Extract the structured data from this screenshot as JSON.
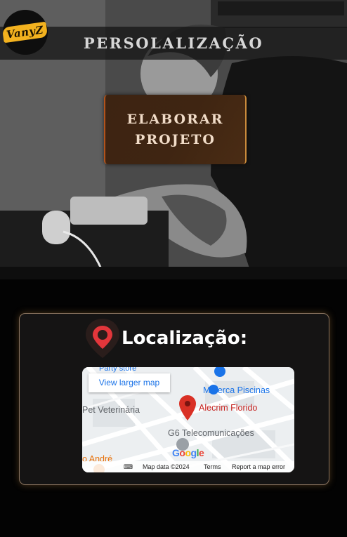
{
  "header": {
    "logo_text": "VanyZ",
    "title": "PERSOLALIZAÇÃO"
  },
  "hero": {
    "cta_label": "ELABORAR\nPROJETO"
  },
  "location": {
    "title": "Localização:",
    "map": {
      "view_larger": "View larger map",
      "places": {
        "party_store": "Party store",
        "maferca": "Maferca Piscinas",
        "pet": "Pet Veterinária",
        "alecrim": "Alecrim Florido",
        "g6": "G6 Telecomunicações",
        "andre": "o André"
      },
      "google_logo": "Google",
      "footer": {
        "map_data": "Map data ©2024",
        "terms": "Terms",
        "report": "Report a map error"
      }
    }
  },
  "colors": {
    "cta_bg": "#3f2512",
    "cta_text": "#f1dcc8",
    "card_border": "#8a7460",
    "pin_red": "#e3363b",
    "map_link": "#1a73e8"
  },
  "icons": [
    "logo-badge",
    "location-pin-icon",
    "map-marker-icon",
    "keyboard-icon",
    "street-view-icon"
  ]
}
